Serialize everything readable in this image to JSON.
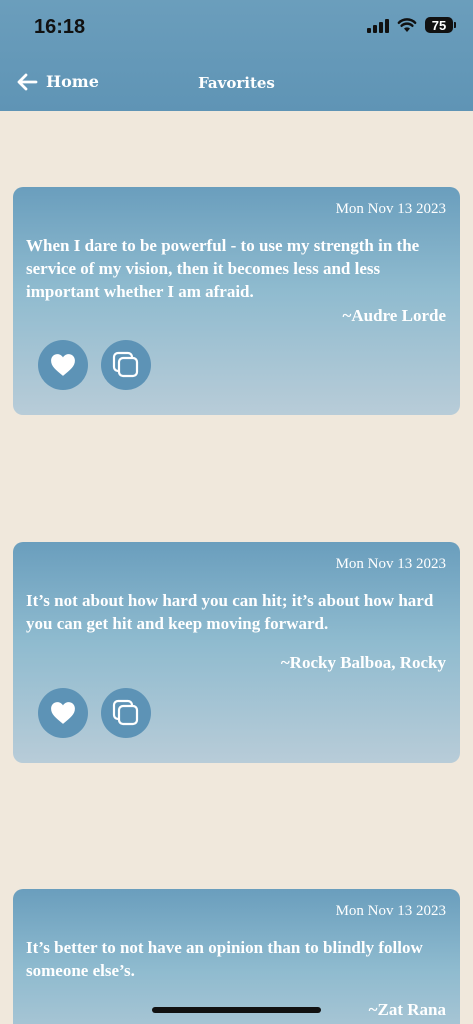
{
  "status_bar": {
    "time": "16:18",
    "battery": "75"
  },
  "nav": {
    "back_label": "Home",
    "title": "Favorites"
  },
  "favorites": [
    {
      "date": "Mon Nov 13 2023",
      "quote": "When I dare to be powerful - to use my strength in the service of my vision, then it becomes less and less important whether I am afraid.",
      "author": "~Audre Lorde"
    },
    {
      "date": "Mon Nov 13 2023",
      "quote": "It’s not about how hard you can hit; it’s about how hard you can get hit and keep moving forward.",
      "author": "~Rocky Balboa, Rocky"
    },
    {
      "date": "Mon Nov 13 2023",
      "quote": "It’s better to not have an opinion than to blindly follow someone else’s.",
      "author": "~Zat Rana"
    }
  ],
  "icons": {
    "back": "arrow-left-icon",
    "like": "heart-icon",
    "copy": "copy-icon"
  },
  "colors": {
    "background": "#f0e8dc",
    "header": "#6b9ebc",
    "button": "#5d93b6",
    "text_light": "#ffffff"
  }
}
